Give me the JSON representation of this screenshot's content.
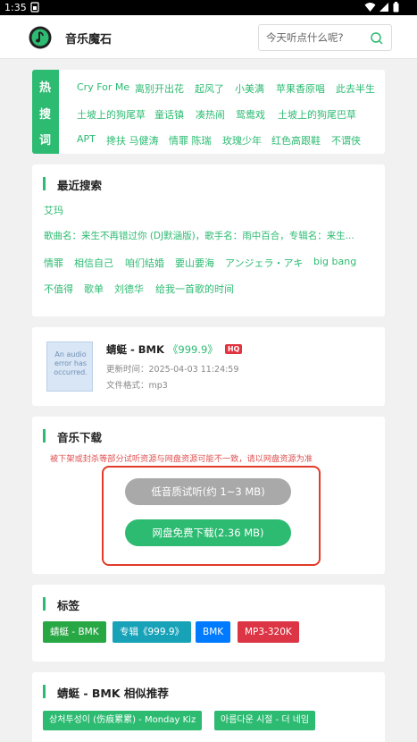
{
  "status_bar": {
    "time": "1:35"
  },
  "header": {
    "site_name": "音乐魔石",
    "search_placeholder": "今天听点什么呢?"
  },
  "hot_search": {
    "label_chars": [
      "热",
      "搜",
      "词"
    ],
    "tags": [
      "Cry For Me",
      "离别开出花",
      "起风了",
      "小美满",
      "苹果香原唱",
      "此去半生",
      "土坡上的狗尾草",
      "童话镇",
      "凑热闹",
      "鸳鸯戏",
      "土坡上的狗尾巴草",
      "APT",
      "搀扶 马健涛",
      "情罪 陈瑞",
      "玫瑰少年",
      "红色高跟鞋",
      "不谓侠"
    ]
  },
  "recent_search": {
    "title": "最近搜索",
    "items": [
      "艾玛",
      "歌曲名：来生不再错过你 (DJ默涵版)，歌手名：雨中百合，专辑名：来生...",
      "情罪",
      "相信自己",
      "咱们结婚",
      "要山要海",
      "アンジェラ・アキ",
      "big bang",
      "不值得",
      "歌单",
      "刘德华",
      "给我一首歌的时间"
    ]
  },
  "song": {
    "cover_text": "An audio error has occurred.",
    "title": "蜻蜓 - BMK",
    "album": "《999.9》",
    "quality_badge": "HQ",
    "updated": "更新时间：2025-04-03 11:24:59",
    "format": "文件格式：mp3"
  },
  "download": {
    "title": "音乐下载",
    "notice": "被下架或封杀等部分试听资源与网盘资源可能不一致，请以网盘资源为准",
    "low_quality_label": "低音质试听(约 1~3 MB)",
    "netdisk_label": "网盘免费下载(2.36 MB)"
  },
  "tags": {
    "title": "标签",
    "items": [
      {
        "text": "蜻蜓 - BMK",
        "color": "#28a745"
      },
      {
        "text": "专辑《999.9》",
        "color": "#17a2b8"
      },
      {
        "text": "BMK",
        "color": "#007bff"
      },
      {
        "text": "MP3-320K",
        "color": "#dc3545"
      }
    ]
  },
  "similar": {
    "title": "蜻蜓 - BMK 相似推荐",
    "items": [
      "상처투성이 (伤痕累累) - Monday Kiz",
      "아름다운 시절 - 더 네임"
    ]
  },
  "colors": {
    "accent": "#2dbb72",
    "alert": "#e04f4f",
    "frame": "#e23b2a"
  }
}
